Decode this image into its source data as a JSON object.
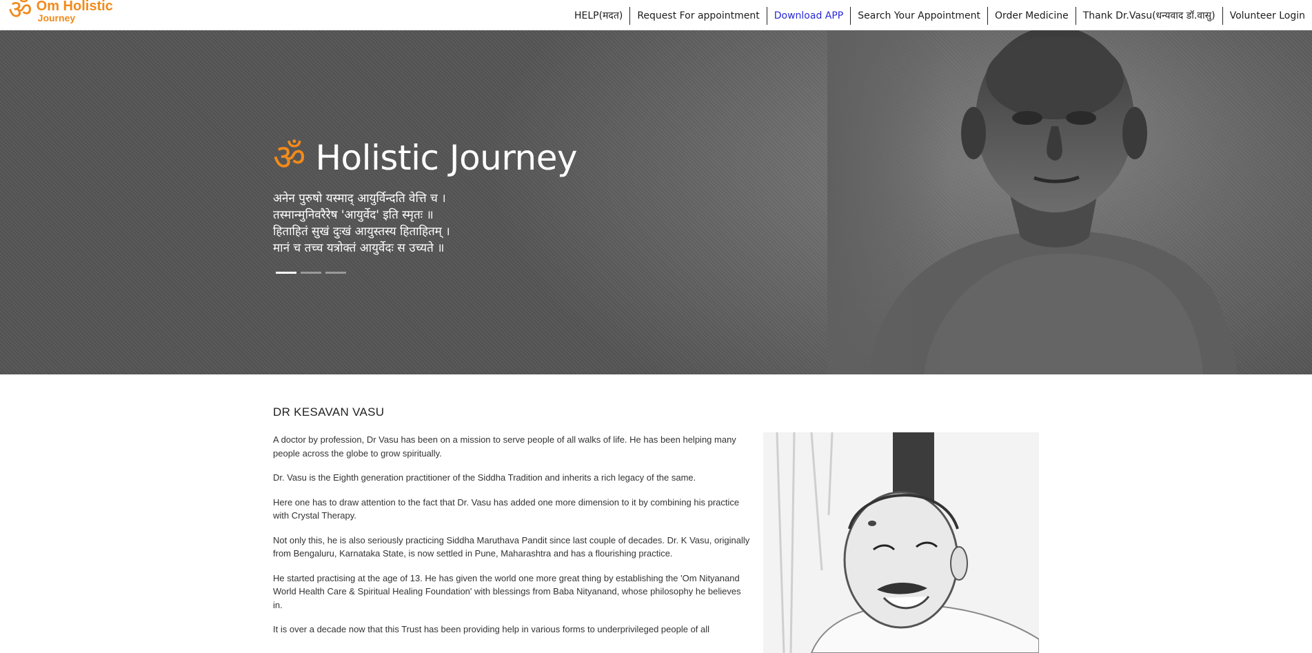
{
  "logo": {
    "mark": "ॐ",
    "line1": "Om Holistic",
    "line2": "Journey"
  },
  "nav": {
    "items": [
      "HELP(मदत)",
      "Request For appointment",
      "Download APP",
      "Search Your Appointment",
      "Order Medicine",
      "Thank Dr.Vasu(धन्यवाद डॉ.वासु)",
      "Volunteer Login"
    ],
    "active_color": "#2828d6"
  },
  "hero": {
    "om": "ॐ",
    "title": "Holistic Journey",
    "verse": [
      "अनेन पुरुषो यस्माद् आयुर्विन्दति वेत्ति च ।",
      "तस्मान्मुनिवरैरेष 'आयुर्वेद' इति स्मृतः ॥",
      "हिताहितं सुखं दुःखं आयुस्तस्य हिताहितम् ।",
      "मानं च तच्च यत्रोक्तं आयुर्वेदः स उच्यते ॥"
    ],
    "slides": 3,
    "active_slide": 1
  },
  "about": {
    "heading": "DR KESAVAN VASU",
    "paragraphs": [
      "A doctor by profession, Dr Vasu has been on a mission to serve people of all walks of life. He has been helping many people across the globe to grow spiritually.",
      "Dr. Vasu is the Eighth generation practitioner of the Siddha Tradition and inherits a rich legacy of the same.",
      "Here one has to draw attention to the fact that Dr. Vasu has added one more dimension to it by combining his practice with Crystal Therapy.",
      "Not only this, he is also seriously practicing Siddha Maruthava Pandit since last couple of decades. Dr. K Vasu, originally from Bengaluru, Karnataka State, is now settled in Pune, Maharashtra and has a flourishing practice.",
      "He started practising at the age of 13. He has given the world one more great thing by establishing the 'Om Nityanand World Health Care & Spiritual Healing Foundation' with blessings from Baba Nityanand, whose philosophy he believes in.",
      "It is over a decade now that this Trust has been providing help in various forms to underprivileged people of all"
    ]
  },
  "colors": {
    "brand": "#f28a1a",
    "hero_bg": "#666666"
  }
}
